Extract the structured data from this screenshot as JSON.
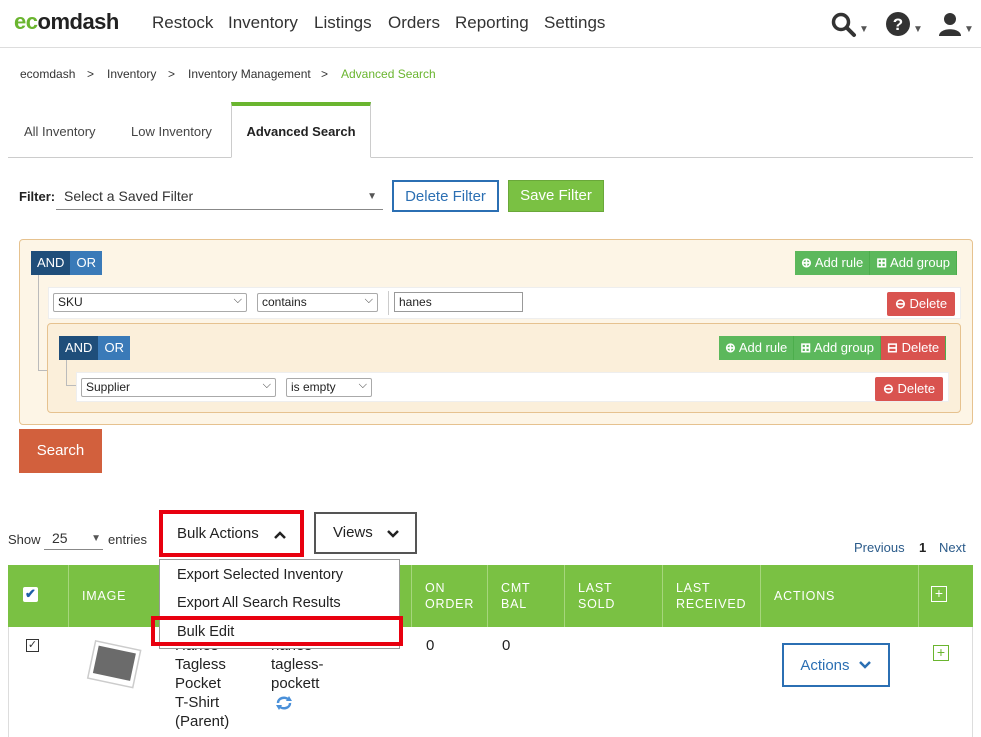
{
  "brand": {
    "logo_prefix": "e",
    "logo_o": "c",
    "logo_suffix": "omdash"
  },
  "nav": [
    "Restock",
    "Inventory",
    "Listings",
    "Orders",
    "Reporting",
    "Settings"
  ],
  "breadcrumb": {
    "items": [
      "ecomdash",
      "Inventory",
      "Inventory Management"
    ],
    "separator": ">",
    "current": "Advanced Search"
  },
  "tabs": {
    "all": "All Inventory",
    "low": "Low Inventory",
    "advanced": "Advanced Search"
  },
  "filter": {
    "label": "Filter:",
    "placeholder": "Select a Saved Filter",
    "delete": "Delete Filter",
    "save": "Save Filter"
  },
  "builder": {
    "and": "AND",
    "or": "OR",
    "add_rule": "Add rule",
    "add_group": "Add group",
    "delete": "Delete",
    "rule1": {
      "field": "SKU",
      "operator": "contains",
      "value": "hanes"
    },
    "rule2": {
      "field": "Supplier",
      "operator": "is empty"
    }
  },
  "search_button": "Search",
  "table_controls": {
    "show": "Show",
    "entries_count": "25",
    "entries": "entries",
    "bulk_actions": "Bulk Actions",
    "views": "Views",
    "previous": "Previous",
    "page": "1",
    "next": "Next"
  },
  "bulk_menu": [
    "Export Selected Inventory",
    "Export All Search Results",
    "Bulk Edit"
  ],
  "columns": {
    "image": "IMAGE",
    "on_order_1": "ON",
    "on_order_2": "ORDER",
    "cmt_1": "CMT",
    "cmt_2": "BAL",
    "sold_1": "LAST",
    "sold_2": "SOLD",
    "recv_1": "LAST",
    "recv_2": "RECEIVED",
    "actions": "ACTIONS"
  },
  "row": {
    "name_lines": [
      "Hanes",
      "Tagless",
      "Pocket",
      "T-Shirt",
      "(Parent)"
    ],
    "sku_lines": [
      "hanes",
      "tagless-",
      "pockett"
    ],
    "on_order": "0",
    "cmt_bal": "0",
    "actions": "Actions"
  },
  "colors": {
    "green": "#7ac143",
    "blue": "#2b6fb3",
    "red": "#d9534f",
    "highlight": "#e8000f"
  }
}
